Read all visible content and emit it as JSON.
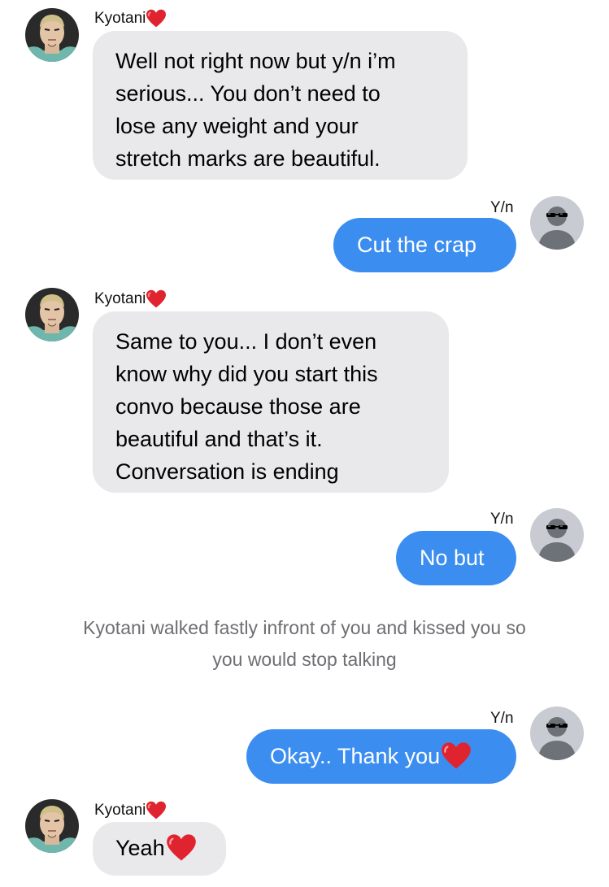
{
  "messages": [
    {
      "sender": "Kyotani",
      "lines": [
        "Well not right now but y/n i’m",
        "serious... You don’t need to",
        "lose any weight and your",
        "stretch marks are beautiful."
      ]
    },
    {
      "sender": "Y/n",
      "text": "Cut the crap"
    },
    {
      "sender": "Kyotani",
      "lines": [
        "Same to you... I don’t even",
        "know why did you start this",
        "convo because those are",
        "beautiful and that’s it.",
        "Conversation is ending"
      ]
    },
    {
      "sender": "Y/n",
      "text": "No but"
    },
    {
      "narration": [
        "Kyotani walked fastly infront of you and kissed you so",
        "you would stop talking"
      ]
    },
    {
      "sender": "Y/n",
      "text": "Okay.. Thank you",
      "emoji": "heart"
    },
    {
      "sender": "Kyotani",
      "text": "Yeah",
      "emoji": "heart"
    }
  ],
  "icons": {
    "name_emoji": "heart-icon",
    "incoming_avatar": "kyotani-avatar",
    "outgoing_avatar": "sunglasses-silhouette-avatar"
  },
  "colors": {
    "outgoing_bubble": "#3b8ef0",
    "incoming_bubble": "#e9e9eb",
    "heart": "#e0242f",
    "narration_text": "#6e6e73"
  }
}
